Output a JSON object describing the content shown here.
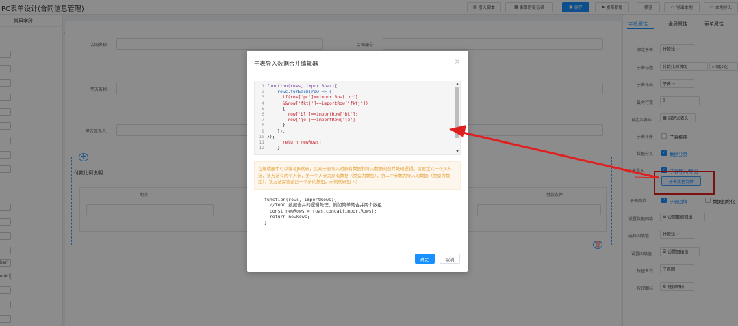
{
  "app": {
    "title": "PC表单设计(合同信息管理)"
  },
  "toolbar": {
    "import_script": "引入脚本",
    "history": "表单历史记录",
    "save": "保存",
    "publish": "发布新版",
    "preview": "预览",
    "export_local": "导出本地",
    "import_local": "本地导入"
  },
  "left": {
    "tabs": [
      "",
      "常用字段"
    ],
    "items": [
      "",
      "",
      "",
      "",
      "",
      "",
      "",
      "",
      "",
      "",
      "",
      "",
      "",
      "ber)",
      "enic)",
      "",
      "",
      ""
    ]
  },
  "form": {
    "contract_name_label": "合同名称:",
    "contract_no_label": "合同编号:",
    "party_a_label": "甲方名称:",
    "party_b_contact_label": "甲方联系人:",
    "subtable_title": "付款比例说明",
    "col_period": "期次",
    "col_condition": "付款条件"
  },
  "right": {
    "tabs": {
      "field_props": "字段属性",
      "global_props": "全局属性",
      "form_props": "表单属性"
    },
    "bind_subtable_label": "绑定子表",
    "bind_subtable_value": "付款比",
    "subtable_title_label": "子表标题",
    "subtable_title_value": "付款比例说明",
    "sync_btn": "同步化",
    "subtable_type_label": "子表布局",
    "subtable_type_value": "子表",
    "max_rows_label": "最大行数",
    "max_rows_value": "0",
    "custom_header_label": "自定义表头",
    "custom_header_btn": "自定义表头",
    "subtable_sort_label": "子表排序",
    "subtable_sort_text": "子表排序",
    "data_paging_label": "数据分页",
    "data_paging_text": "数据分页",
    "import_label": "子表导入",
    "import_text": "子表导入/导出",
    "merge_btn": "子表数据合并",
    "echo_label": "子表回填",
    "echo_text": "子表回填",
    "data_init_text": "数据初始化",
    "echo_set_label": "设置数据回填",
    "echo_set_btn": "设置数据回填",
    "select_echo_label": "选择回填值",
    "select_echo_value": "付款比",
    "echo_field_label": "设置回填值",
    "echo_field_btn": "设置回填值",
    "button_name_label": "按钮名称",
    "button_name_value": "子表回",
    "button_icon_label": "按钮图标",
    "button_icon_btn": "选择图标"
  },
  "modal": {
    "title": "子表导入数据合并编辑器",
    "code_lines": [
      "function(rows, importRows){",
      "    rows.forEach(row => {",
      "      if(row['pc']==importRow['pc']",
      "      &&row['fktj']==importRow['fktj'])",
      "      {",
      "        row['bl']==importRow['bl'];",
      "        row['je']==importRow['je']",
      "      }",
      "    });",
      "});",
      "      return newRows;",
      "    }"
    ],
    "notice": "在编辑器中可以编写JS代码，实现子表导入时原有数据和导入数据的合并处理逻辑。需要定义一个JS方法，该方法有两个入参，第一个入参为原有数据（类型为数组），第二个参数为导入的数据（类型为数组），该方法需要返回一个新的数组。示例代码如下：",
    "example": "function(rows, importRows){\n  //TODO 数据合并的逻辑处理，例如简单的合并两个数组\n  const newRows = rows.concat(importRows);\n  return newRows;\n}",
    "ok": "确定",
    "cancel": "取消"
  },
  "colors": {
    "primary": "#1890ff",
    "highlight": "#e02020",
    "warning": "#e6a23c"
  }
}
